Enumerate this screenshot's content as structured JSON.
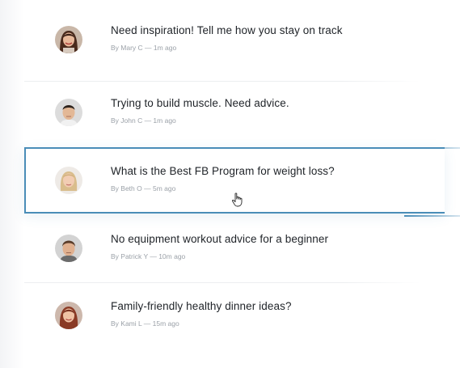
{
  "colors": {
    "selected_border": "#4a8db8",
    "title_text": "#1f2328",
    "meta_text": "#9ba1a8"
  },
  "posts": [
    {
      "title": "Need inspiration! Tell me how you stay on track",
      "meta": "By Mary C — 1m ago",
      "avatar": "avatar-woman-dark-hair-icon"
    },
    {
      "title": "Trying to build muscle. Need advice.",
      "meta": "By John C — 1m ago",
      "avatar": "avatar-man-short-hair-icon"
    },
    {
      "title": "What is the Best FB Program for weight loss?",
      "meta": "By Beth O — 5m ago",
      "avatar": "avatar-woman-blonde-icon",
      "selected": true
    },
    {
      "title": "No equipment workout advice for a beginner",
      "meta": "By Patrick Y — 10m ago",
      "avatar": "avatar-man-brown-hair-icon"
    },
    {
      "title": "Family-friendly healthy dinner ideas?",
      "meta": "By Kami L — 15m ago",
      "avatar": "avatar-woman-red-hair-icon"
    }
  ],
  "cursor": "hand-pointer-icon"
}
